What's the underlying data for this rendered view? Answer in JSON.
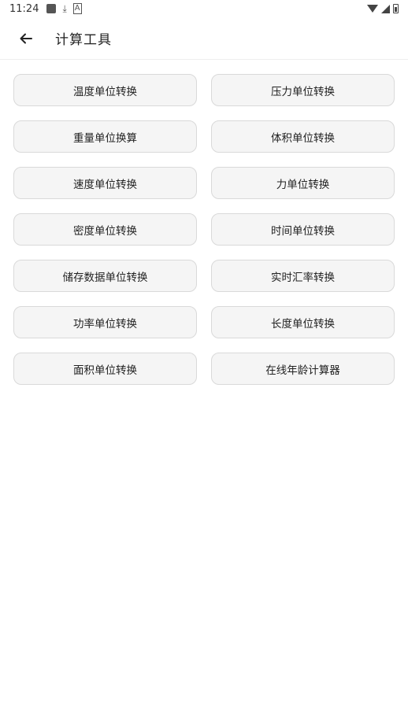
{
  "status_bar": {
    "time": "11:24",
    "download_glyph": "⤓",
    "a_glyph": "A"
  },
  "app_bar": {
    "title": "计算工具",
    "back_icon": "arrow-left"
  },
  "tools": [
    {
      "label": "温度单位转换"
    },
    {
      "label": "压力单位转换"
    },
    {
      "label": "重量单位换算"
    },
    {
      "label": "体积单位转换"
    },
    {
      "label": "速度单位转换"
    },
    {
      "label": "力单位转换"
    },
    {
      "label": "密度单位转换"
    },
    {
      "label": "时间单位转换"
    },
    {
      "label": "储存数据单位转换"
    },
    {
      "label": "实时汇率转换"
    },
    {
      "label": "功率单位转换"
    },
    {
      "label": "长度单位转换"
    },
    {
      "label": "面积单位转换"
    },
    {
      "label": "在线年龄计算器"
    }
  ]
}
